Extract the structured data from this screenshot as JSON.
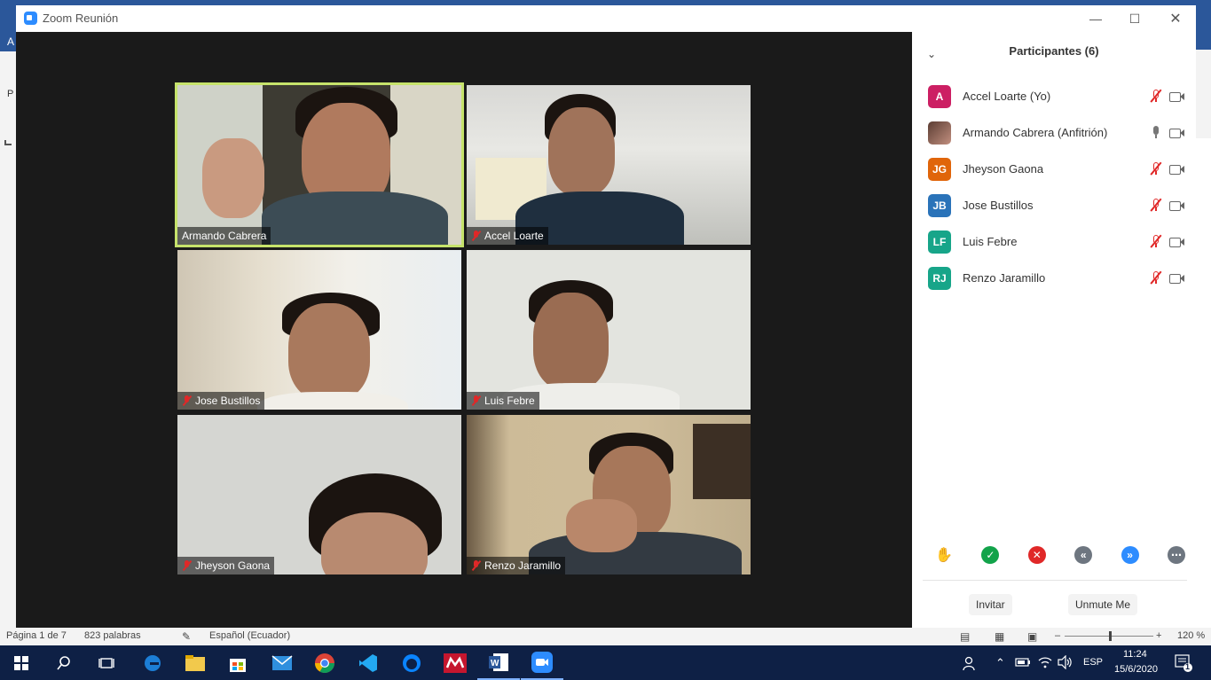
{
  "window": {
    "title": "Zoom Reunión"
  },
  "word_bg": {
    "left_letter": "A",
    "left_p": "P"
  },
  "tiles": [
    {
      "name": "Armando Cabrera",
      "muted": false,
      "active": true
    },
    {
      "name": "Accel Loarte",
      "muted": true,
      "active": false
    },
    {
      "name": "Jose Bustillos",
      "muted": true,
      "active": false
    },
    {
      "name": "Luis Febre",
      "muted": true,
      "active": false
    },
    {
      "name": "Jheyson Gaona",
      "muted": true,
      "active": false
    },
    {
      "name": "Renzo Jaramillo",
      "muted": true,
      "active": false
    }
  ],
  "panel": {
    "title": "Participantes (6)",
    "participants": [
      {
        "initials": "A",
        "name": "Accel Loarte (Yo)",
        "color": "#cc1f63",
        "muted": true
      },
      {
        "initials": "",
        "name": "Armando Cabrera (Anfitrión)",
        "color": "#7a5a4a",
        "muted": false
      },
      {
        "initials": "JG",
        "name": "Jheyson Gaona",
        "color": "#e0650a",
        "muted": true
      },
      {
        "initials": "JB",
        "name": "Jose Bustillos",
        "color": "#2a73b9",
        "muted": true
      },
      {
        "initials": "LF",
        "name": "Luis Febre",
        "color": "#17a589",
        "muted": true
      },
      {
        "initials": "RJ",
        "name": "Renzo Jaramillo",
        "color": "#17a589",
        "muted": true
      }
    ],
    "invite_label": "Invitar",
    "unmute_label": "Unmute Me"
  },
  "statusbar": {
    "page": "Página 1 de 7",
    "words": "823 palabras",
    "language": "Español (Ecuador)",
    "zoom": "120 %"
  },
  "taskbar": {
    "lang": "ESP",
    "time": "11:24",
    "date": "15/6/2020",
    "notifications": "1"
  }
}
